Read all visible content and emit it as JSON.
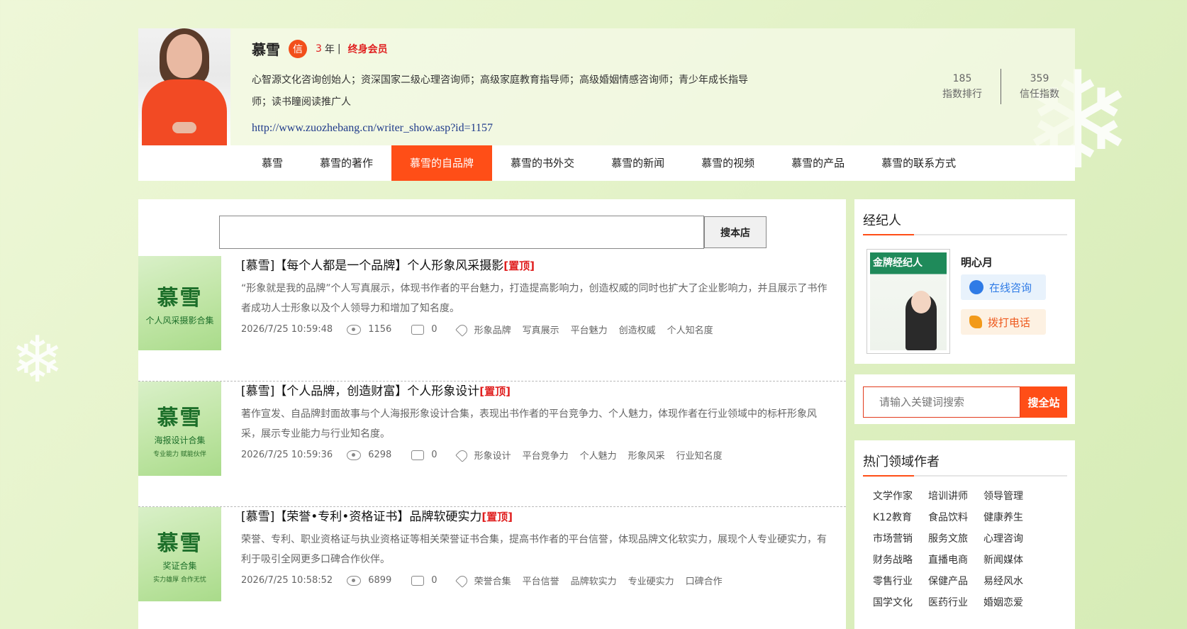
{
  "profile": {
    "name": "慕雪",
    "badge": "信",
    "years": "3",
    "years_unit": "年",
    "separator": "|",
    "membership": "终身会员",
    "bio": "心智源文化咨询创始人；资深国家二级心理咨询师；高级家庭教育指导师；高级婚姻情感咨询师；青少年成长指导师；读书瞳阅读推广人",
    "url": "http://www.zuozhebang.cn/writer_show.asp?id=1157",
    "stats": [
      {
        "value": "185",
        "label": "指数排行"
      },
      {
        "value": "359",
        "label": "信任指数"
      }
    ]
  },
  "nav": {
    "items": [
      "慕雪",
      "慕雪的著作",
      "慕雪的自品牌",
      "慕雪的书外交",
      "慕雪的新闻",
      "慕雪的视频",
      "慕雪的产品",
      "慕雪的联系方式"
    ],
    "active": "慕雪的自品牌"
  },
  "shop_search": {
    "value": "",
    "button": "搜本店"
  },
  "articles": [
    {
      "title": "[慕雪]【每个人都是一个品牌】个人形象风采摄影",
      "pin": "[置顶]",
      "thumb": {
        "line1": "慕雪",
        "line2": "个人风采摄影合集",
        "line3": ""
      },
      "desc": "“形象就是我的品牌”个人写真展示，体现书作者的平台魅力，打造提高影响力，创造权威的同时也扩大了企业影响力，并且展示了书作者成功人士形象以及个人领导力和增加了知名度。",
      "date": "2026/7/25 10:59:48",
      "views": "1156",
      "comments": "0",
      "tags": [
        "形象品牌",
        "写真展示",
        "平台魅力",
        "创造权威",
        "个人知名度"
      ]
    },
    {
      "title": "[慕雪]【个人品牌，创造财富】个人形象设计",
      "pin": "[置顶]",
      "thumb": {
        "line1": "慕雪",
        "line2": "海报设计合集",
        "line3": "专业能力 赋能伙伴"
      },
      "desc": "著作宣发、自品牌封面故事与个人海报形象设计合集，表现出书作者的平台竞争力、个人魅力，体现作者在行业领域中的标杆形象风采，展示专业能力与行业知名度。",
      "date": "2026/7/25 10:59:36",
      "views": "6298",
      "comments": "0",
      "tags": [
        "形象设计",
        "平台竞争力",
        "个人魅力",
        "形象风采",
        "行业知名度"
      ]
    },
    {
      "title": "[慕雪]【荣誉•专利•资格证书】品牌软硬实力",
      "pin": "[置顶]",
      "thumb": {
        "line1": "慕雪",
        "line2": "奖证合集",
        "line3": "实力雄厚 合作无忧"
      },
      "desc": "荣誉、专利、职业资格证与执业资格证等相关荣誉证书合集，提高书作者的平台信誉，体现品牌文化软实力，展现个人专业硬实力，有利于吸引全网更多口碑合作伙伴。",
      "date": "2026/7/25 10:58:52",
      "views": "6899",
      "comments": "0",
      "tags": [
        "荣誉合集",
        "平台信誉",
        "品牌软实力",
        "专业硬实力",
        "口碑合作"
      ]
    }
  ],
  "agent": {
    "title": "经纪人",
    "name": "明心月",
    "magazine_title": "金牌经纪人",
    "consult_button": "在线咨询",
    "call_button": "拨打电话"
  },
  "site_search": {
    "placeholder": "请输入关键词搜索",
    "button": "搜全站"
  },
  "hot_authors": {
    "title": "热门领域作者",
    "categories": [
      "文学作家",
      "培训讲师",
      "领导管理",
      "K12教育",
      "食品饮料",
      "健康养生",
      "市场营销",
      "服务文旅",
      "心理咨询",
      "财务战略",
      "直播电商",
      "新闻媒体",
      "零售行业",
      "保健产品",
      "易经风水",
      "国学文化",
      "医药行业",
      "婚姻恋爱"
    ]
  },
  "colors": {
    "accent": "#ff4e17",
    "pin": "#e02020",
    "link": "#1f3a8a",
    "consult": "#2f7be6"
  }
}
